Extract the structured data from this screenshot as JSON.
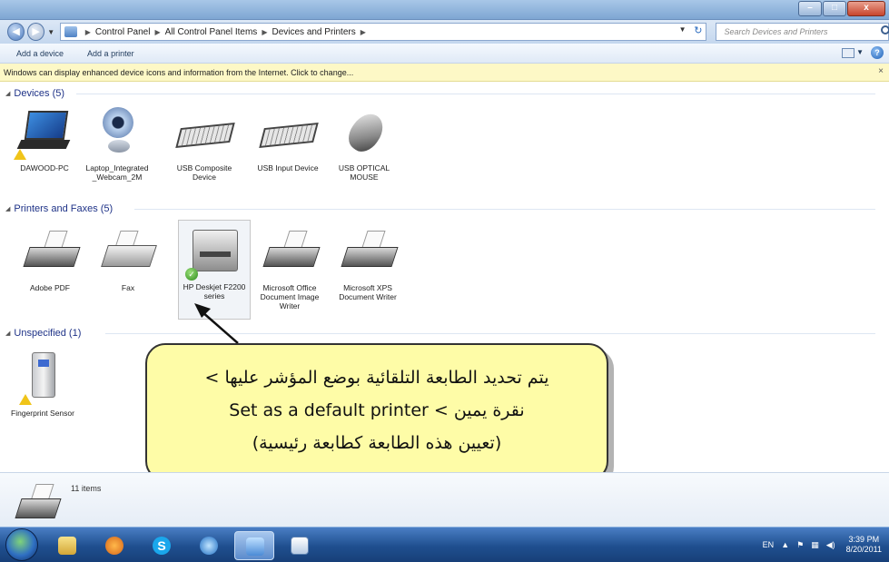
{
  "window": {
    "caption_min": "–",
    "caption_max": "□",
    "caption_close": "x"
  },
  "address": {
    "crumbs": [
      "Control Panel",
      "All Control Panel Items",
      "Devices and Printers"
    ],
    "search_placeholder": "Search Devices and Printers"
  },
  "commands": {
    "add_device": "Add a device",
    "add_printer": "Add a printer"
  },
  "infobar": {
    "text": "Windows can display enhanced device icons and information from the Internet. Click to change..."
  },
  "groups": {
    "devices": {
      "title": "Devices (5)",
      "items": [
        {
          "label": "DAWOOD-PC",
          "icon": "laptop-icon",
          "warning": true
        },
        {
          "label": "Laptop_Integrated_Webcam_2M",
          "icon": "webcam-icon"
        },
        {
          "label": "USB Composite Device",
          "icon": "keyboard-icon"
        },
        {
          "label": "USB Input Device",
          "icon": "keyboard-icon"
        },
        {
          "label": "USB OPTICAL MOUSE",
          "icon": "mouse-icon"
        }
      ]
    },
    "printers": {
      "title": "Printers and Faxes (5)",
      "items": [
        {
          "label": "Adobe PDF",
          "icon": "printer-icon"
        },
        {
          "label": "Fax",
          "icon": "fax-icon"
        },
        {
          "label": "HP Deskjet F2200 series",
          "icon": "printer-icon",
          "default": true,
          "selected": true
        },
        {
          "label": "Microsoft Office Document Image Writer",
          "icon": "printer-icon"
        },
        {
          "label": "Microsoft XPS Document Writer",
          "icon": "printer-icon"
        }
      ]
    },
    "unspecified": {
      "title": "Unspecified (1)",
      "items": [
        {
          "label": "Fingerprint Sensor",
          "icon": "fingerprint-sensor-icon",
          "warning": true
        }
      ]
    }
  },
  "callout": {
    "line1": "يتم تحديد الطابعة التلقائية بوضع المؤشر عليها >",
    "line2": "نقرة يمين > Set as a default printer",
    "line3": "(تعيين هذه الطابعة كطابعة رئيسية)"
  },
  "details": {
    "count": "11 items"
  },
  "taskbar": {
    "language": "EN",
    "time": "3:39 PM",
    "date": "8/20/2011",
    "apps": [
      "windows-explorer",
      "media-player",
      "skype",
      "internet-explorer",
      "control-panel",
      "paint"
    ]
  },
  "colors": {
    "callout_fill": "#fefca7",
    "infobar_fill": "#fdf8c6",
    "group_title": "#1e3287"
  }
}
